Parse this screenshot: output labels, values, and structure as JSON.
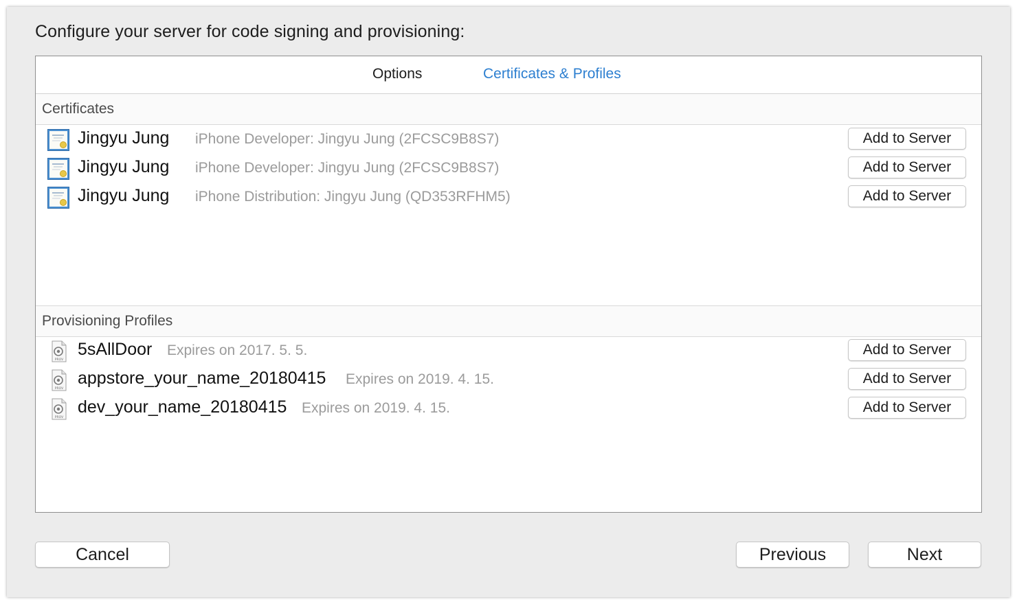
{
  "dialog": {
    "heading": "Configure your server for code signing and provisioning:"
  },
  "tabs": [
    {
      "label": "Options",
      "selected": false
    },
    {
      "label": "Certificates & Profiles",
      "selected": true
    }
  ],
  "certificates": {
    "header": "Certificates",
    "items": [
      {
        "name": "Jingyu Jung",
        "detail": "iPhone Developer: Jingyu Jung (2FCSC9B8S7)",
        "button": "Add to Server",
        "icon": "certificate-icon"
      },
      {
        "name": "Jingyu Jung",
        "detail": "iPhone Developer: Jingyu Jung (2FCSC9B8S7)",
        "button": "Add to Server",
        "icon": "certificate-icon"
      },
      {
        "name": "Jingyu Jung",
        "detail": "iPhone Distribution: Jingyu Jung (QD353RFHM5)",
        "button": "Add to Server",
        "icon": "certificate-icon"
      }
    ]
  },
  "profiles": {
    "header": "Provisioning Profiles",
    "items": [
      {
        "name": "5sAllDoor",
        "detail": "Expires on 2017. 5. 5.",
        "button": "Add to Server",
        "icon": "provisioning-profile-icon",
        "icon_label": "PROV"
      },
      {
        "name": "appstore_your_name_20180415",
        "detail": "Expires on 2019. 4. 15.",
        "button": "Add to Server",
        "icon": "provisioning-profile-icon",
        "icon_label": "PROV"
      },
      {
        "name": "dev_your_name_20180415",
        "detail": "Expires on 2019. 4. 15.",
        "button": "Add to Server",
        "icon": "provisioning-profile-icon",
        "icon_label": "PROV"
      }
    ]
  },
  "footer": {
    "cancel_label": "Cancel",
    "previous_label": "Previous",
    "next_label": "Next"
  },
  "colors": {
    "accent": "#2d7fd0",
    "detail_text": "#9b9b9b",
    "window_bg": "#ececec"
  }
}
